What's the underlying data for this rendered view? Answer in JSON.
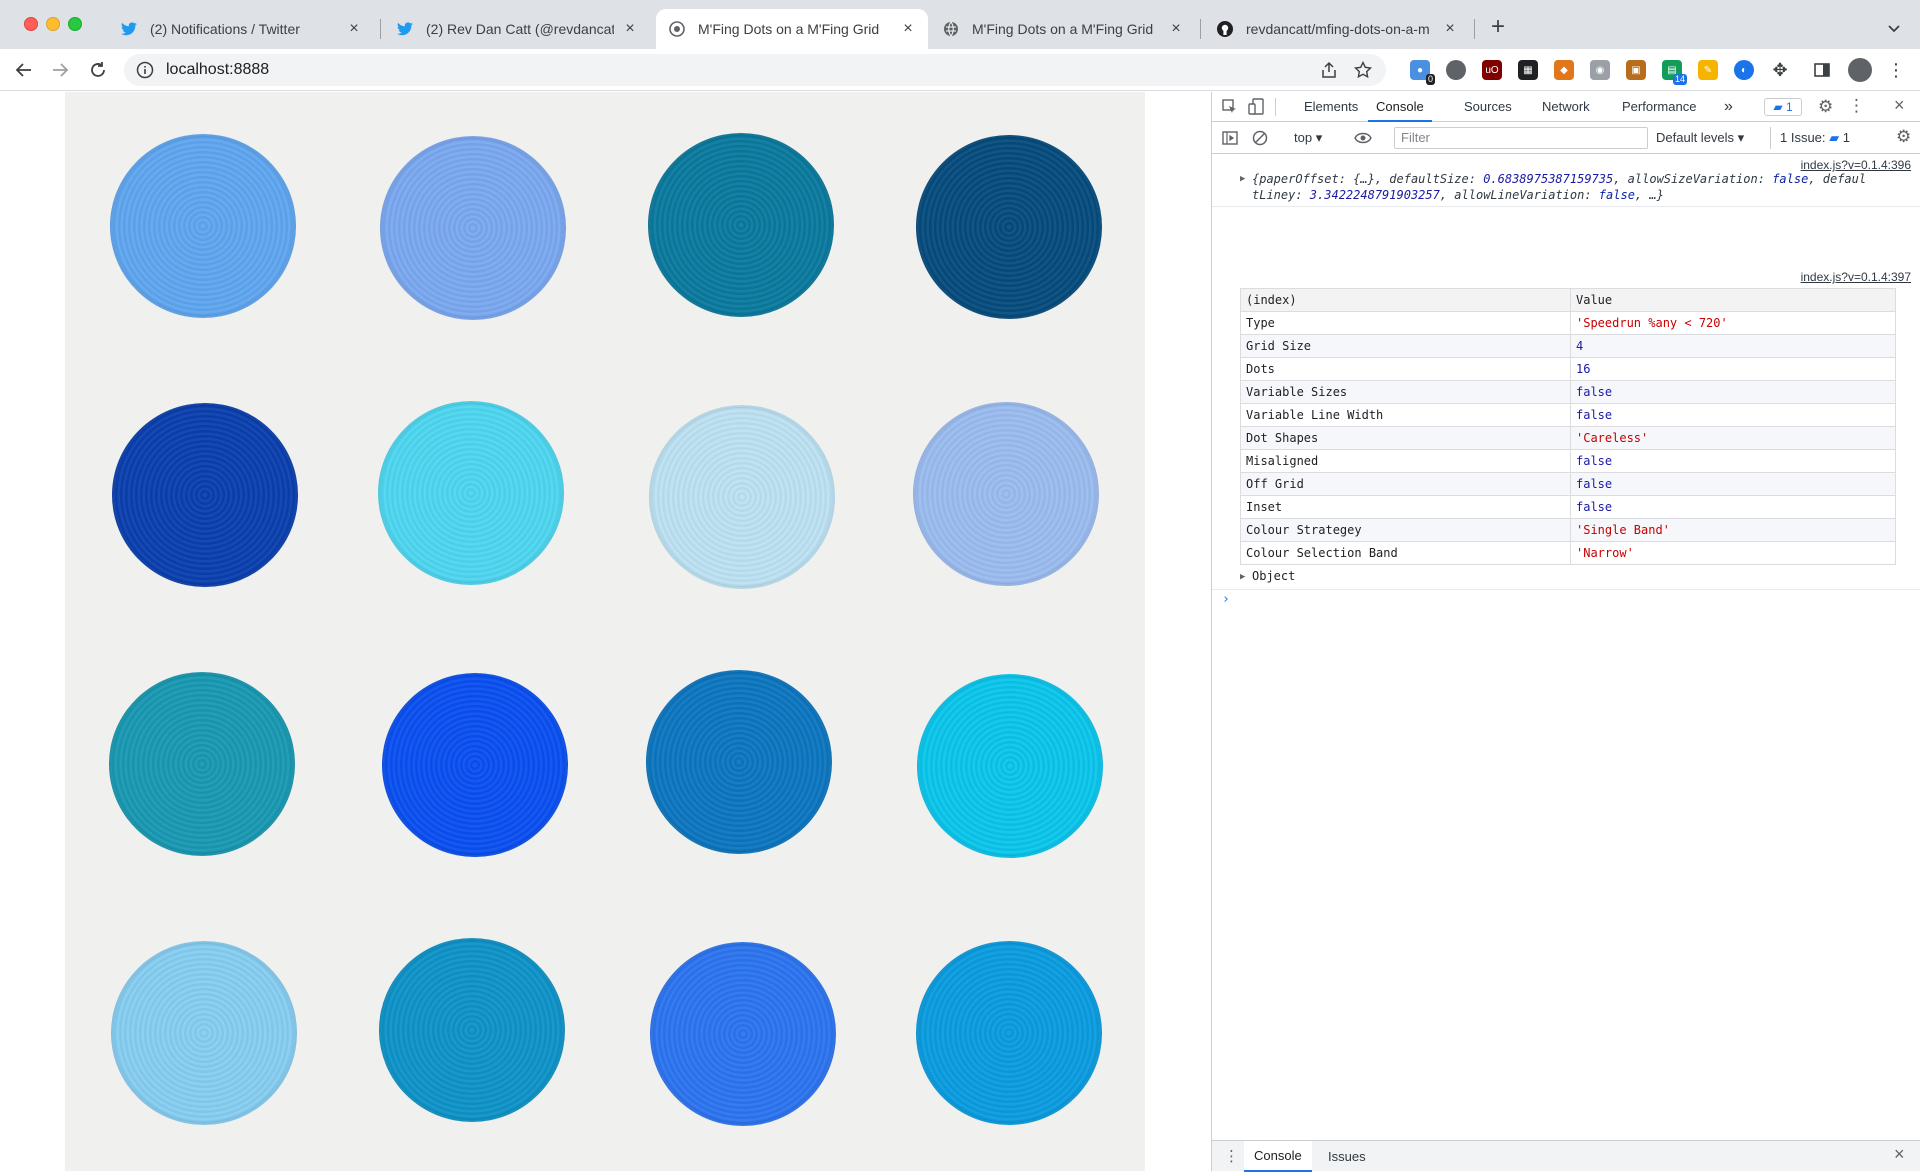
{
  "tabs": [
    {
      "title": "(2) Notifications / Twitter",
      "favicon": "twitter-icon"
    },
    {
      "title": "(2) Rev Dan Catt (@revdancatt",
      "favicon": "twitter-icon"
    },
    {
      "title": "M'Fing Dots on a M'Fing Grid",
      "favicon": "github-icon",
      "active": true
    },
    {
      "title": "M'Fing Dots on a M'Fing Grid",
      "favicon": "globe-icon"
    },
    {
      "title": "revdancatt/mfing-dots-on-a-m",
      "favicon": "github-icon"
    }
  ],
  "address_bar": {
    "url": "localhost:8888"
  },
  "extensions": {
    "badge_counter": "0",
    "badge_sheets": "14"
  },
  "dots": [
    {
      "row": 1,
      "col": 1,
      "color": "#5fa6f0"
    },
    {
      "row": 1,
      "col": 2,
      "color": "#7aa8f0"
    },
    {
      "row": 1,
      "col": 3,
      "color": "#0a7a9e"
    },
    {
      "row": 1,
      "col": 4,
      "color": "#064c7e"
    },
    {
      "row": 2,
      "col": 1,
      "color": "#0a3fae"
    },
    {
      "row": 2,
      "col": 2,
      "color": "#4ed6f0"
    },
    {
      "row": 2,
      "col": 3,
      "color": "#bde2f3"
    },
    {
      "row": 2,
      "col": 4,
      "color": "#9bbcf0"
    },
    {
      "row": 3,
      "col": 1,
      "color": "#1899b2"
    },
    {
      "row": 3,
      "col": 2,
      "color": "#0a4ff0"
    },
    {
      "row": 3,
      "col": 3,
      "color": "#0c76c0"
    },
    {
      "row": 3,
      "col": 4,
      "color": "#0ac6ec"
    },
    {
      "row": 4,
      "col": 1,
      "color": "#86cdf1"
    },
    {
      "row": 4,
      "col": 2,
      "color": "#0e93c8"
    },
    {
      "row": 4,
      "col": 3,
      "color": "#2c74f0"
    },
    {
      "row": 4,
      "col": 4,
      "color": "#0a9ce0"
    }
  ],
  "devtools": {
    "tabs": [
      "Elements",
      "Console",
      "Sources",
      "Network",
      "Performance"
    ],
    "active_tab": "Console",
    "messages_badge": "1",
    "context": "top",
    "filter_placeholder": "Filter",
    "levels": "Default levels",
    "issues_label": "1 Issue:",
    "issues_count": "1",
    "log1_source": "index.js?v=0.1.4:396",
    "log1_line1_a": "{paperOffset: {…}, defaultSize: ",
    "log1_line1_b": "0.6838975387159735",
    "log1_line1_c": ", allowSizeVariation: ",
    "log1_line1_d": "false",
    "log1_line1_e": ", defaul",
    "log1_line2_a": "tLiney: ",
    "log1_line2_b": "3.3422248791903257",
    "log1_line2_c": ", allowLineVariation: ",
    "log1_line2_d": "false",
    "log1_line2_e": ", …}",
    "log2_source": "index.js?v=0.1.4:397",
    "table_headers": [
      "(index)",
      "Value"
    ],
    "table_rows": [
      {
        "key": "Type",
        "value": "'Speedrun %any < 720'",
        "kind": "str"
      },
      {
        "key": "Grid Size",
        "value": "4",
        "kind": "num"
      },
      {
        "key": "Dots",
        "value": "16",
        "kind": "num"
      },
      {
        "key": "Variable Sizes",
        "value": "false",
        "kind": "bool"
      },
      {
        "key": "Variable Line Width",
        "value": "false",
        "kind": "bool"
      },
      {
        "key": "Dot Shapes",
        "value": "'Careless'",
        "kind": "str"
      },
      {
        "key": "Misaligned",
        "value": "false",
        "kind": "bool"
      },
      {
        "key": "Off Grid",
        "value": "false",
        "kind": "bool"
      },
      {
        "key": "Inset",
        "value": "false",
        "kind": "bool"
      },
      {
        "key": "Colour Strategey",
        "value": "'Single Band'",
        "kind": "str"
      },
      {
        "key": "Colour Selection Band",
        "value": "'Narrow'",
        "kind": "str"
      }
    ],
    "object_label": "Object",
    "drawer_tabs": [
      "Console",
      "Issues"
    ]
  }
}
